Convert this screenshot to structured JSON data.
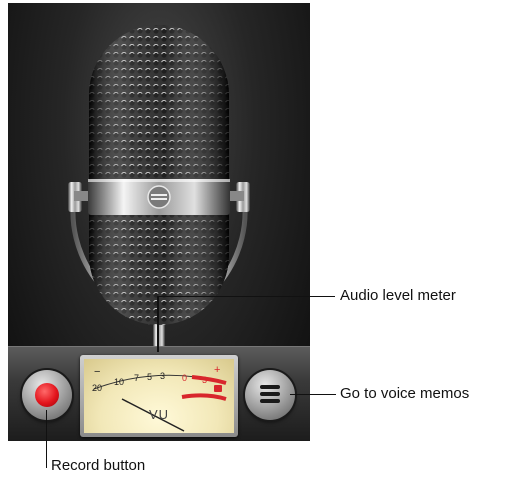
{
  "meter": {
    "scale_black": [
      "20",
      "10",
      "7",
      "5",
      "3"
    ],
    "scale_red": [
      "0",
      "3"
    ],
    "minus": "−",
    "plus": "+",
    "unit": "VU"
  },
  "callouts": {
    "audio_level_meter": "Audio level meter",
    "go_to_voice_memos": "Go to voice memos",
    "record_button": "Record button"
  },
  "colors": {
    "record_red": "#e3151d",
    "meter_face": "#f2e8b8",
    "meter_red_zone": "#d8262c"
  },
  "icons": {
    "record": "record-dot-icon",
    "menu": "list-icon"
  }
}
